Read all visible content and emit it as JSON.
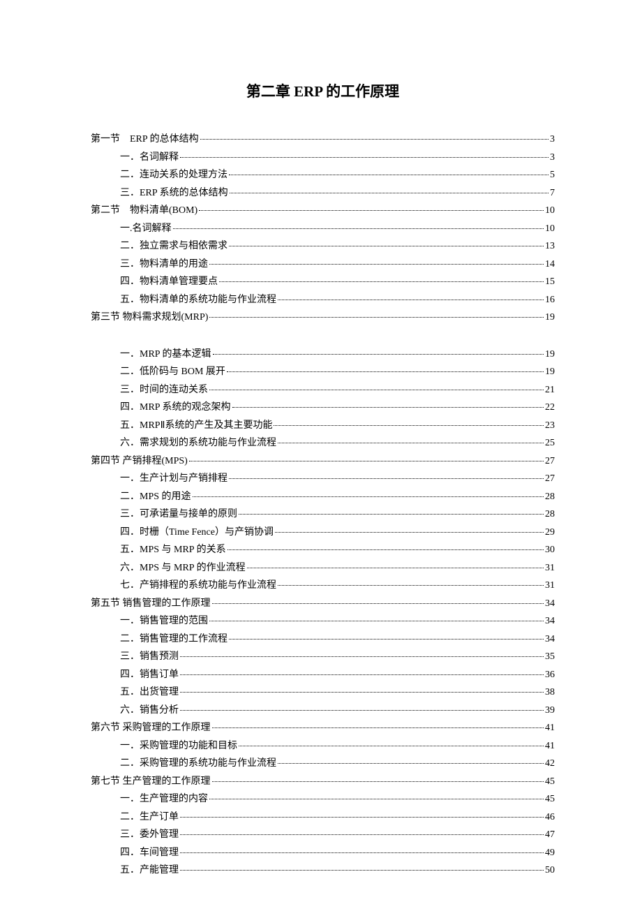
{
  "title": "第二章 ERP 的工作原理",
  "toc": [
    {
      "level": 1,
      "label": "第一节　ERP 的总体结构",
      "page": "3"
    },
    {
      "level": 2,
      "label": "一．名词解释",
      "page": "3"
    },
    {
      "level": 2,
      "label": "二．连动关系的处理方法",
      "page": "5"
    },
    {
      "level": 2,
      "label": "三．ERP 系统的总体结构",
      "page": "7"
    },
    {
      "level": 1,
      "label": "第二节　物料清单(BOM)",
      "page": "10"
    },
    {
      "level": 2,
      "label": "一.名词解释",
      "page": "10"
    },
    {
      "level": 2,
      "label": "二．独立需求与相依需求",
      "page": "13"
    },
    {
      "level": 2,
      "label": "三．物料清单的用途",
      "page": "14"
    },
    {
      "level": 2,
      "label": "四．物料清单管理要点",
      "page": "15"
    },
    {
      "level": 2,
      "label": "五．物料清单的系统功能与作业流程",
      "page": "16"
    },
    {
      "level": 1,
      "label": "第三节  物料需求规划(MRP)",
      "page": "19"
    },
    {
      "gap": true
    },
    {
      "level": 2,
      "label": "一．MRP 的基本逻辑",
      "page": "19"
    },
    {
      "level": 2,
      "label": "二．低阶码与 BOM 展开",
      "page": "19"
    },
    {
      "level": 2,
      "label": "三．时间的连动关系",
      "page": "21"
    },
    {
      "level": 2,
      "label": "四．MRP 系统的观念架构",
      "page": "22"
    },
    {
      "level": 2,
      "label": "五．MRPⅡ系统的产生及其主要功能",
      "page": "23"
    },
    {
      "level": 2,
      "label": "六．需求规划的系统功能与作业流程",
      "page": "25"
    },
    {
      "level": 1,
      "label": "第四节  产销排程(MPS)",
      "page": "27"
    },
    {
      "level": 2,
      "label": "一．生产计划与产销排程",
      "page": "27"
    },
    {
      "level": 2,
      "label": "二．MPS 的用途",
      "page": "28"
    },
    {
      "level": 2,
      "label": "三．可承诺量与接单的原则",
      "page": "28"
    },
    {
      "level": 2,
      "label": "四．时栅（Time Fence）与产销协调",
      "page": "29"
    },
    {
      "level": 2,
      "label": "五．MPS 与 MRP 的关系",
      "page": "30"
    },
    {
      "level": 2,
      "label": "六．MPS 与 MRP 的作业流程",
      "page": "31"
    },
    {
      "level": 2,
      "label": "七．产销排程的系统功能与作业流程",
      "page": "31"
    },
    {
      "level": 1,
      "label": "第五节  销售管理的工作原理",
      "page": "34"
    },
    {
      "level": 2,
      "label": "一．销售管理的范围",
      "page": "34"
    },
    {
      "level": 2,
      "label": "二．销售管理的工作流程",
      "page": "34"
    },
    {
      "level": 2,
      "label": "三．销售预测",
      "page": "35"
    },
    {
      "level": 2,
      "label": "四．销售订单",
      "page": "36"
    },
    {
      "level": 2,
      "label": "五．出货管理",
      "page": "38"
    },
    {
      "level": 2,
      "label": "六．销售分析",
      "page": "39"
    },
    {
      "level": 1,
      "label": "第六节  采购管理的工作原理",
      "page": "41"
    },
    {
      "level": 2,
      "label": "一．采购管理的功能和目标",
      "page": "41"
    },
    {
      "level": 2,
      "label": "二．采购管理的系统功能与作业流程",
      "page": "42"
    },
    {
      "level": 1,
      "label": "第七节  生产管理的工作原理",
      "page": "45"
    },
    {
      "level": 2,
      "label": "一．生产管理的内容",
      "page": "45"
    },
    {
      "level": 2,
      "label": "二．生产订单",
      "page": "46"
    },
    {
      "level": 2,
      "label": "三．委外管理",
      "page": "47"
    },
    {
      "level": 2,
      "label": "四．车间管理",
      "page": "49"
    },
    {
      "level": 2,
      "label": "五．产能管理",
      "page": "50"
    }
  ]
}
